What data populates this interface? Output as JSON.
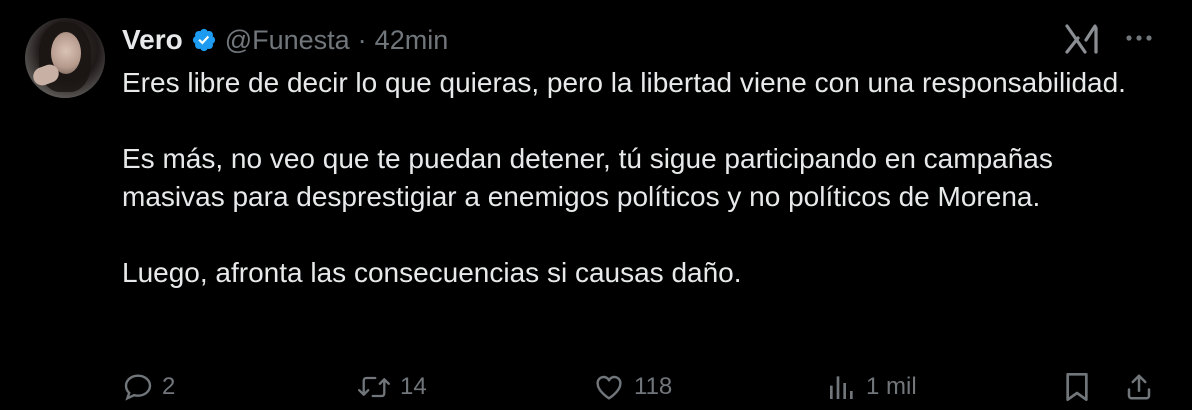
{
  "tweet": {
    "author": {
      "name": "Vero",
      "handle": "@Funesta",
      "separator": "·",
      "time": "42min",
      "verified": true
    },
    "paragraphs": [
      "Eres libre de decir lo que quieras, pero la libertad viene con una responsabilidad.",
      "Es más, no veo que te puedan detener, tú sigue participando en campañas masivas para desprestigiar a enemigos políticos y no políticos de Morena.",
      "Luego, afronta las consecuencias si causas daño."
    ],
    "stats": {
      "replies": "2",
      "reposts": "14",
      "likes": "118",
      "views": "1 mil"
    }
  },
  "icons": {
    "verified": "verified-badge-icon",
    "grok": "grok-icon",
    "more": "more-icon",
    "reply": "reply-icon",
    "repost": "repost-icon",
    "like": "like-icon",
    "views": "views-icon",
    "bookmark": "bookmark-icon",
    "share": "share-icon"
  },
  "colors": {
    "background": "#000000",
    "text": "#e7e9ea",
    "muted": "#71767b",
    "verified": "#1d9bf0"
  }
}
